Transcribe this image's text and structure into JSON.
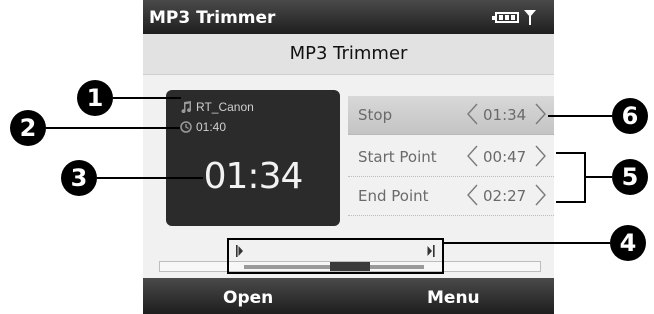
{
  "status_bar": {
    "app_title": "MP3 Trimmer"
  },
  "title_bar": {
    "title": "MP3 Trimmer"
  },
  "player": {
    "track_name": "RT_Canon",
    "duration": "01:40",
    "current_time": "01:34"
  },
  "settings": [
    {
      "label": "Stop",
      "value": "01:34",
      "selected": true
    },
    {
      "label": "Start Point",
      "value": "00:47",
      "selected": false
    },
    {
      "label": "End Point",
      "value": "02:27",
      "selected": false
    }
  ],
  "softkeys": {
    "left": "Open",
    "right": "Menu"
  },
  "callouts": [
    "1",
    "2",
    "3",
    "4",
    "5",
    "6"
  ],
  "icons": {
    "track": "music-note-icon",
    "duration": "clock-icon",
    "battery": "battery-icon",
    "signal": "signal-antenna-icon"
  }
}
